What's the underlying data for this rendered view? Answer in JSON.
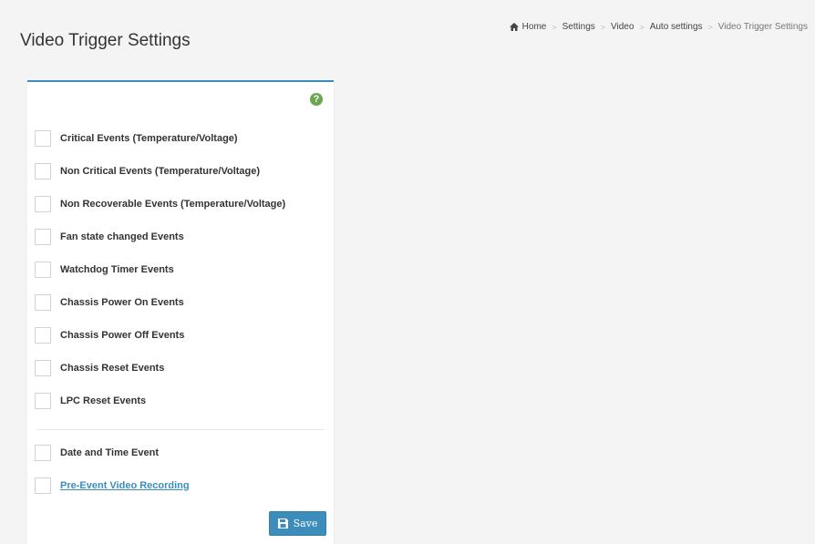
{
  "page": {
    "title": "Video Trigger Settings"
  },
  "breadcrumb": {
    "items": [
      "Home",
      "Settings",
      "Video",
      "Auto settings",
      "Video Trigger Settings"
    ],
    "separator": ">"
  },
  "help": {
    "icon": "help-circle-icon",
    "label": "?"
  },
  "triggers": [
    {
      "label": "Critical Events (Temperature/Voltage)",
      "checked": false
    },
    {
      "label": "Non Critical Events (Temperature/Voltage)",
      "checked": false
    },
    {
      "label": "Non Recoverable Events (Temperature/Voltage)",
      "checked": false
    },
    {
      "label": "Fan state changed Events",
      "checked": false
    },
    {
      "label": "Watchdog Timer Events",
      "checked": false
    },
    {
      "label": "Chassis Power On Events",
      "checked": false
    },
    {
      "label": "Chassis Power Off Events",
      "checked": false
    },
    {
      "label": "Chassis Reset Events",
      "checked": false
    },
    {
      "label": "LPC Reset Events",
      "checked": false
    }
  ],
  "extra_options": [
    {
      "label": "Date and Time Event",
      "checked": false,
      "is_link": false
    },
    {
      "label": "Pre-Event Video Recording",
      "checked": false,
      "is_link": true
    }
  ],
  "save": {
    "label": "Save",
    "icon": "floppy-disk-icon"
  },
  "colors": {
    "accent": "#3c8dbc",
    "help": "#6aa84f",
    "background": "#f4f4f4"
  }
}
